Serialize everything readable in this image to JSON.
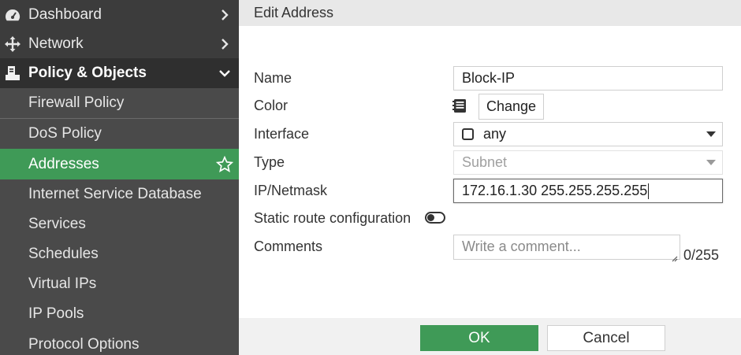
{
  "sidebar": {
    "items": [
      {
        "label": "Dashboard",
        "icon": "gauge-icon"
      },
      {
        "label": "Network",
        "icon": "move-arrows-icon"
      },
      {
        "label": "Policy & Objects",
        "icon": "policy-document-icon"
      }
    ],
    "subitems": [
      {
        "label": "Firewall Policy"
      },
      {
        "label": "DoS Policy"
      },
      {
        "label": "Addresses"
      },
      {
        "label": "Internet Service Database"
      },
      {
        "label": "Services"
      },
      {
        "label": "Schedules"
      },
      {
        "label": "Virtual IPs"
      },
      {
        "label": "IP Pools"
      },
      {
        "label": "Protocol Options"
      }
    ]
  },
  "dialog": {
    "title": "Edit Address",
    "fields": {
      "name_label": "Name",
      "name_value": "Block-IP",
      "color_label": "Color",
      "color_button": "Change",
      "interface_label": "Interface",
      "interface_value": "any",
      "type_label": "Type",
      "type_value": "Subnet",
      "ipnetmask_label": "IP/Netmask",
      "ipnetmask_value": "172.16.1.30 255.255.255.255",
      "static_route_label": "Static route configuration",
      "comments_label": "Comments",
      "comments_placeholder": "Write a comment...",
      "comments_counter": "0/255"
    },
    "buttons": {
      "ok": "OK",
      "cancel": "Cancel"
    }
  },
  "colors": {
    "sidebar_bg": "#3c3c3c",
    "accent_green": "#3f9a57",
    "header_bg": "#e8e8e8"
  }
}
